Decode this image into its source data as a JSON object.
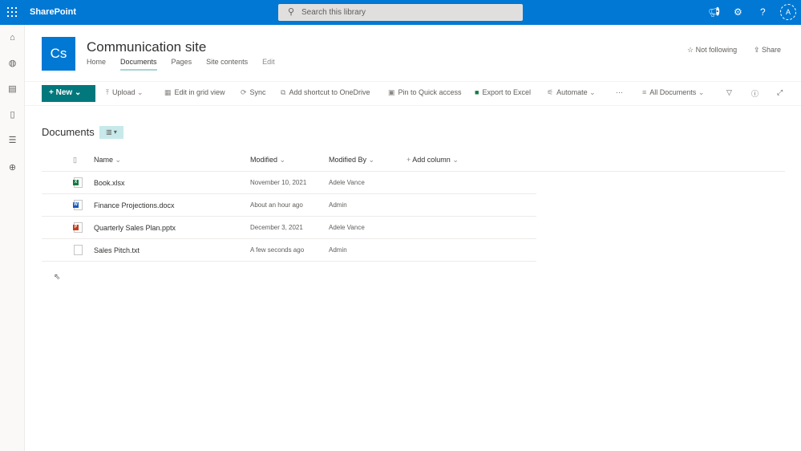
{
  "app": {
    "name": "SharePoint",
    "search_placeholder": "Search this library",
    "avatar": "A"
  },
  "site": {
    "logo": "Cs",
    "title": "Communication site",
    "nav": [
      "Home",
      "Documents",
      "Pages",
      "Site contents",
      "Edit"
    ],
    "active_nav": "Documents",
    "follow": "Not following",
    "share": "Share"
  },
  "commands": {
    "new": "New",
    "upload": "Upload",
    "grid": "Edit in grid view",
    "sync": "Sync",
    "shortcut": "Add shortcut to OneDrive",
    "pin": "Pin to Quick access",
    "export": "Export to Excel",
    "automate": "Automate",
    "more": "···",
    "view": "All Documents"
  },
  "library": {
    "title": "Documents",
    "columns": {
      "name": "Name",
      "modified": "Modified",
      "modified_by": "Modified By",
      "add": "Add column"
    },
    "rows": [
      {
        "name": "Book.xlsx",
        "modified": "November 10, 2021",
        "by": "Adele Vance",
        "type": "excel",
        "color": "#107c41"
      },
      {
        "name": "Finance Projections.docx",
        "modified": "About an hour ago",
        "by": "Admin",
        "type": "word",
        "color": "#185abd"
      },
      {
        "name": "Quarterly Sales Plan.pptx",
        "modified": "December 3, 2021",
        "by": "Adele Vance",
        "type": "powerpoint",
        "color": "#c43e1c"
      },
      {
        "name": "Sales Pitch.txt",
        "modified": "A few seconds ago",
        "by": "Admin",
        "type": "text",
        "color": "#8a8886"
      }
    ]
  },
  "colors": {
    "suite_bar": "#0078d4",
    "accent": "#03787c"
  }
}
